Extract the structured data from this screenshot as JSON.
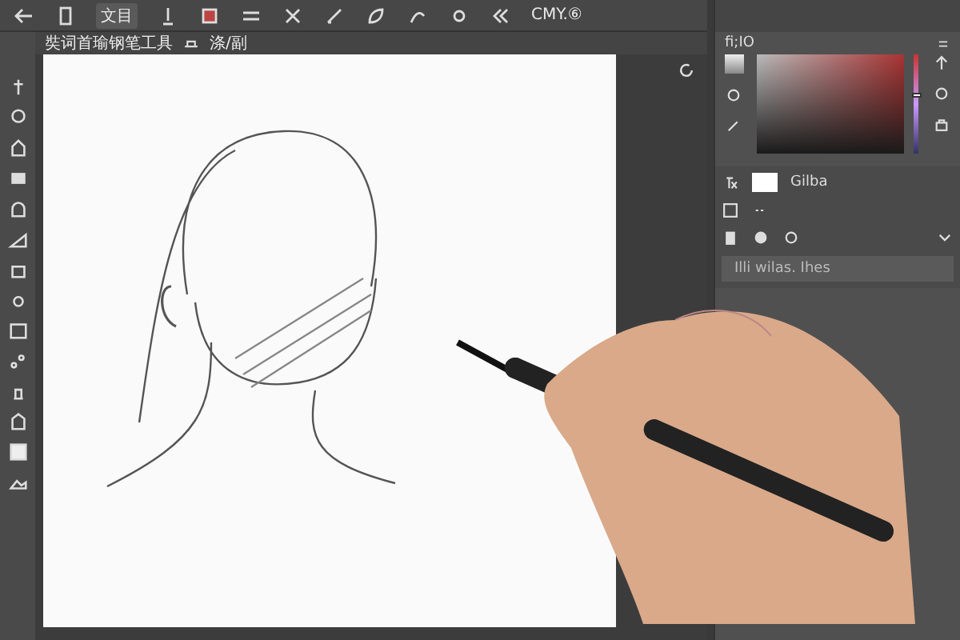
{
  "toolbar": {
    "labels": [
      "文目",
      "CMY.⑥"
    ]
  },
  "document_tab": {
    "title": "奘词首瑜钢笔工具",
    "subtitle": "涤/副"
  },
  "color_panel": {
    "title": "fi;IO",
    "hue_slider": {
      "level": 0.6
    }
  },
  "layers_panel": {
    "layer_name": "Gilba",
    "footer": "Illi wilas. Ihes"
  }
}
